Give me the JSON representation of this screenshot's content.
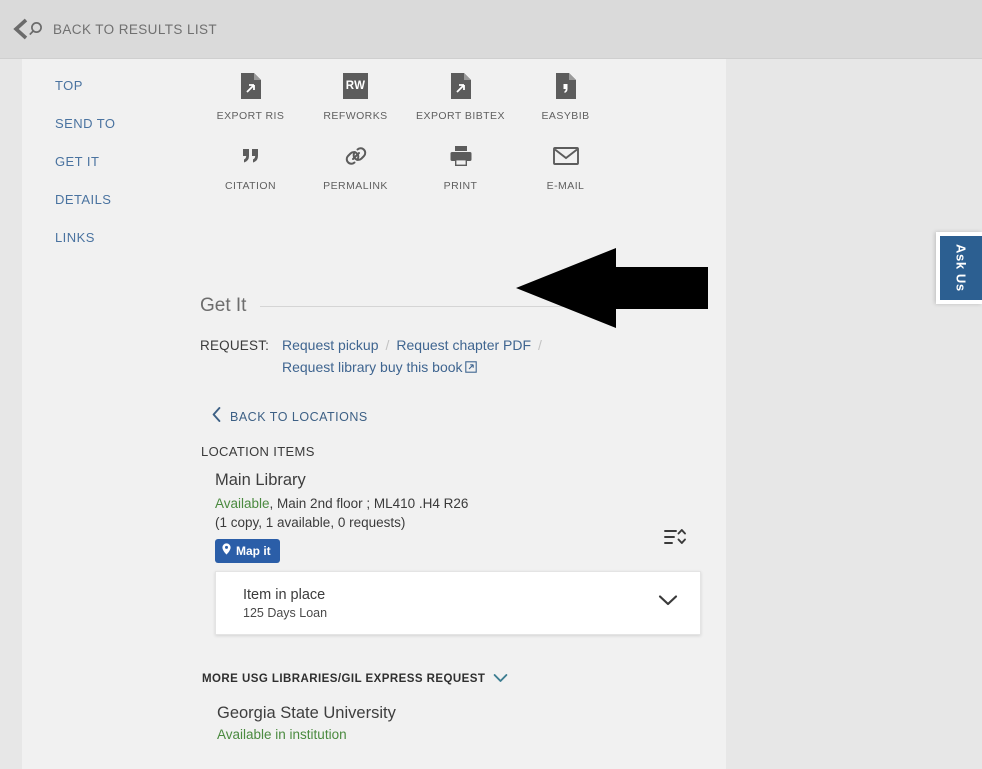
{
  "topbar": {
    "back_label": "BACK TO RESULTS LIST",
    "back_icon": "chevron-left-search-icon"
  },
  "sidebar": {
    "items": [
      {
        "label": "TOP"
      },
      {
        "label": "SEND TO"
      },
      {
        "label": "GET IT"
      },
      {
        "label": "DETAILS"
      },
      {
        "label": "LINKS"
      }
    ]
  },
  "actions": [
    {
      "label": "EXPORT RIS",
      "icon": "file-export-icon"
    },
    {
      "label": "REFWORKS",
      "icon": "refworks-icon",
      "badge": "RW"
    },
    {
      "label": "EXPORT BIBTEX",
      "icon": "file-export-icon"
    },
    {
      "label": "EASYBIB",
      "icon": "file-quote-icon"
    },
    {
      "label": "CITATION",
      "icon": "quote-icon"
    },
    {
      "label": "PERMALINK",
      "icon": "link-icon"
    },
    {
      "label": "PRINT",
      "icon": "printer-icon"
    },
    {
      "label": "E-MAIL",
      "icon": "envelope-icon"
    }
  ],
  "get_it": {
    "title": "Get It",
    "request_label": "REQUEST:",
    "links": [
      {
        "label": "Request pickup",
        "external": false
      },
      {
        "label": "Request chapter PDF",
        "external": false
      }
    ],
    "separator": "/",
    "second_row_link": {
      "label": "Request library buy this book",
      "external": true
    },
    "back_to_locations": "BACK TO LOCATIONS",
    "location_items_heading": "LOCATION ITEMS"
  },
  "location": {
    "name": "Main Library",
    "availability": "Available",
    "availability_detail": ", Main 2nd floor ; ML410 .H4 R26",
    "copies": "(1 copy, 1 available, 0 requests)",
    "map_it": "Map it",
    "map_it_icon": "map-pin-icon",
    "sort_icon": "sort-icon"
  },
  "item_card": {
    "title": "Item in place",
    "subtitle": "125 Days Loan",
    "expand_icon": "chevron-down-icon"
  },
  "more_usg": {
    "label": "MORE USG LIBRARIES/GIL EXPRESS REQUEST",
    "expand_icon": "chevron-down-icon",
    "institution": "Georgia State University",
    "institution_status": "Available in institution"
  },
  "ask_us": {
    "label": "Ask Us"
  },
  "annotation": {
    "type": "arrow-left",
    "color": "#000000"
  },
  "colors": {
    "link_blue": "#3f6590",
    "nav_blue": "#4a73a0",
    "available_green": "#4a8a3f",
    "badge_blue": "#2b5ea8",
    "askus_blue": "#2c5f91",
    "topbar_gray": "#dadada",
    "page_gray": "#f1f1f1"
  }
}
